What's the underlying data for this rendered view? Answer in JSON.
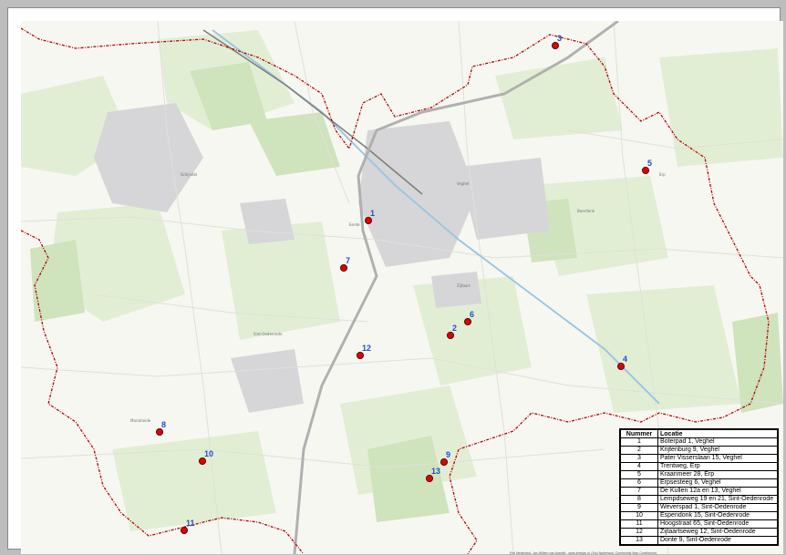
{
  "map": {
    "colors": {
      "background": "#f7f7f2",
      "farmland": "#e2eed4",
      "forest": "#cfe3bd",
      "urban": "#d6d6d8",
      "roads": "#ffffff",
      "highway": "#b0b0b0",
      "railway": "#7f7f7f",
      "canal": "#9cc6e4",
      "boundary": "#b20000",
      "marker_fill": "#e00000",
      "marker_stroke": "#3b0000",
      "marker_label": "#1f4fd1"
    },
    "places": [
      {
        "name": "Veghel"
      },
      {
        "name": "Erp"
      },
      {
        "name": "Sint-Oedenrode"
      },
      {
        "name": "Schijndel"
      },
      {
        "name": "Zijtaart"
      },
      {
        "name": "Eerde"
      },
      {
        "name": "Boerdonk"
      },
      {
        "name": "Mariaheide"
      }
    ],
    "markers": [
      {
        "label": "1"
      },
      {
        "label": "2"
      },
      {
        "label": "3"
      },
      {
        "label": "4"
      },
      {
        "label": "5"
      },
      {
        "label": "6"
      },
      {
        "label": "7"
      },
      {
        "label": "8"
      },
      {
        "label": "9"
      },
      {
        "label": "10"
      },
      {
        "label": "11"
      },
      {
        "label": "12"
      },
      {
        "label": "13"
      }
    ]
  },
  "legend": {
    "header_number": "Nummer",
    "header_location": "Locatie",
    "rows": [
      {
        "num": "1",
        "loc": "Boterpad 1, Veghel"
      },
      {
        "num": "2",
        "loc": "Krijtenburg 9, Veghel"
      },
      {
        "num": "3",
        "loc": "Pater Visserslaan 15, Veghel"
      },
      {
        "num": "4",
        "loc": "Trentweg, Erp"
      },
      {
        "num": "5",
        "loc": "Kraanmeer 28, Erp"
      },
      {
        "num": "6",
        "loc": "Erpsesteeg 6, Veghel"
      },
      {
        "num": "7",
        "loc": "De Kullen 12a en 13, Veghel"
      },
      {
        "num": "8",
        "loc": "Lempdseweg 19 en 21, Sint-Oedenrode"
      },
      {
        "num": "9",
        "loc": "Weverspad 1, Sint-Oedenrode"
      },
      {
        "num": "10",
        "loc": "Espendonk 15, Sint-Oedenrode"
      },
      {
        "num": "11",
        "loc": "Hoogstraat 65, Sint-Oedenrode"
      },
      {
        "num": "12",
        "loc": "Zijtaartseweg 12, Sint-Oedenrode"
      },
      {
        "num": "13",
        "loc": "Donte 9, Sint-Oedenrode"
      }
    ]
  },
  "credits": "Esri Nederland, Jan-Willem van Asseldt - www.imergis.nl | Esri Nederland, Community Map Contributors"
}
